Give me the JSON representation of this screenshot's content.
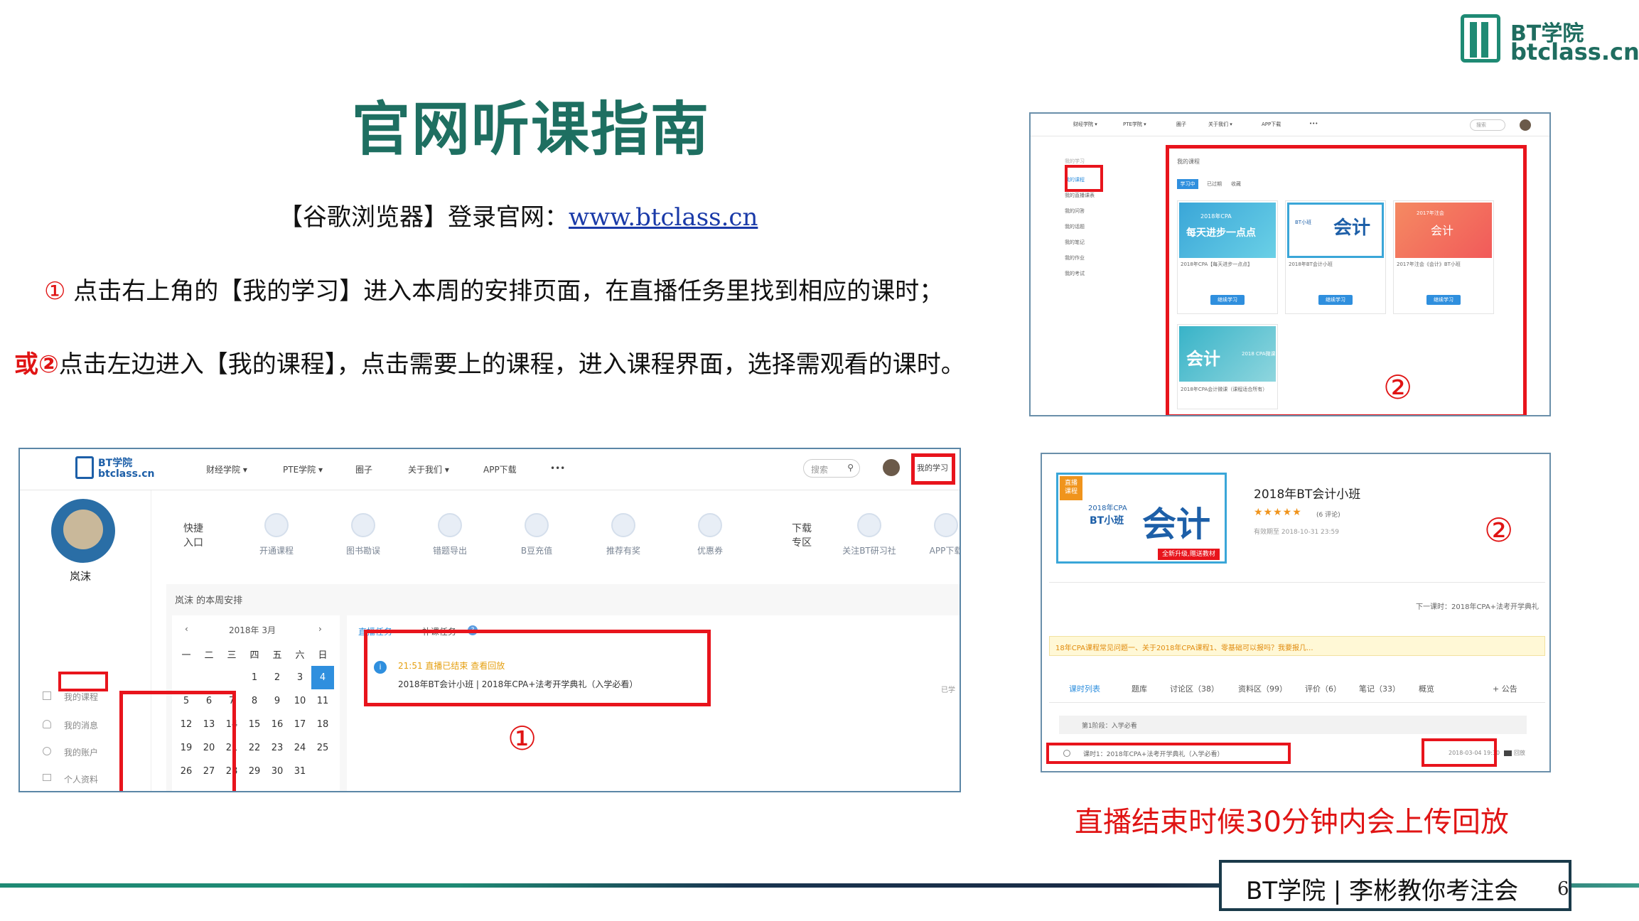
{
  "logo": {
    "name": "BT学院",
    "domain": "btclass.cn",
    "color": "#1f8a74"
  },
  "slide": {
    "title": "官网听课指南",
    "browser_line_prefix": "【谷歌浏览器】登录官网：",
    "browser_link": "www.btclass.cn",
    "step1_num": "①",
    "step1_text": " 点击右上角的【我的学习】进入本周的安排页面，在直播任务里找到相应的课时；",
    "step2_or": "或②",
    "step2_text": "点击左边进入【我的课程】，点击需要上的课程，进入课程界面，选择需观看的课时。",
    "upload_note": "直播结束时候30分钟内会上传回放",
    "footer_text": "BT学院 | 李彬教你考注会",
    "page_number": "6",
    "marker1": "①",
    "marker2": "②",
    "accent": "#1e6f61",
    "highlight": "#e8141c"
  },
  "main_shot": {
    "logo_name": "BT学院",
    "logo_domain": "btclass.cn",
    "nav": [
      "财经学院 ▾",
      "PTE学院 ▾",
      "圈子",
      "关于我们 ▾",
      "APP下载",
      "•••"
    ],
    "search_placeholder": "搜索",
    "my_study": "我的学习",
    "user_name": "岚沫",
    "side_menu": [
      "我的课程",
      "我的消息",
      "我的账户",
      "个人资料"
    ],
    "quick_entry": "快捷\n入口",
    "quick_items": [
      "开通课程",
      "图书勘误",
      "错题导出",
      "B豆充值",
      "推荐有奖",
      "优惠券"
    ],
    "download": "下载\n专区",
    "quick_items2": [
      "关注BT研习社",
      "APP下载"
    ],
    "week_title": "岚沫 的本周安排",
    "calendar_month": "2018年 3月",
    "weekdays": [
      "一",
      "二",
      "三",
      "四",
      "五",
      "六",
      "日"
    ],
    "weeks": [
      [
        "",
        "",
        "",
        "1",
        "2",
        "3",
        "4"
      ],
      [
        "5",
        "6",
        "7",
        "8",
        "9",
        "10",
        "11"
      ],
      [
        "12",
        "13",
        "14",
        "15",
        "16",
        "17",
        "18"
      ],
      [
        "19",
        "20",
        "21",
        "22",
        "23",
        "24",
        "25"
      ],
      [
        "26",
        "27",
        "28",
        "29",
        "30",
        "31",
        ""
      ]
    ],
    "tab_live": "直播任务",
    "tab_makeup": "补课任务",
    "task_time": "21:51 直播已结束  查看回放",
    "task_title": "2018年BT会计小班 | 2018年CPA+法考开学典礼（入学必看）",
    "task_status": "已学"
  },
  "courses_shot": {
    "nav": [
      "财经学院 ▾",
      "PTE学院 ▾",
      "圈子",
      "关于我们 ▾",
      "APP下载",
      "•••"
    ],
    "search_placeholder": "搜索",
    "breadcrumb": "我的学习",
    "side": [
      "我的课程",
      "我的直播课表",
      "我的问答",
      "我的话题",
      "我的笔记",
      "我的作业",
      "我的考试"
    ],
    "section_title": "我的课程",
    "tabs": [
      "学习中",
      "已过期",
      "收藏"
    ],
    "courses": [
      {
        "banner": "每天进步一点点",
        "sub": "2018年CPA",
        "name": "2018年CPA【每天进步一点点】",
        "btn": "继续学习"
      },
      {
        "banner": "会计",
        "sub": "BT小班",
        "name": "2018年BT会计小班",
        "btn": "继续学习"
      },
      {
        "banner": "会计",
        "sub": "2017年注会",
        "name": "2017年注会《会计》BT小班",
        "btn": "继续学习"
      },
      {
        "banner": "会计",
        "sub": "2018 CPA微课",
        "name": "2018年CPA会计微课（课程适合所有）",
        "btn": ""
      }
    ]
  },
  "detail_shot": {
    "badge": "直播\n课程",
    "banner_sub": "2018年CPA",
    "banner_class": "BT小班",
    "banner_big": "会计",
    "banner_tag": "全新升级,赠送教材",
    "course_title": "2018年BT会计小班",
    "stars": "★★★★★",
    "reviews": "(6 评论)",
    "valid": "有效期至    2018-10-31 23:59",
    "next": "下一课时：2018年CPA+法考开学典礼",
    "notice": "18年CPA课程常见问题一、关于2018年CPA课程1、零基础可以报吗？我要报几...",
    "tabs": [
      "课时列表",
      "题库",
      "讨论区（38）",
      "资料区（99）",
      "评价（6）",
      "笔记（33）",
      "概览",
      "+ 公告"
    ],
    "stage": "第1阶段：入学必看",
    "lesson": "课时1：2018年CPA+法考开学典礼（入学必看）",
    "lesson_time": "2018-03-04 19:30",
    "replay": "回放"
  }
}
